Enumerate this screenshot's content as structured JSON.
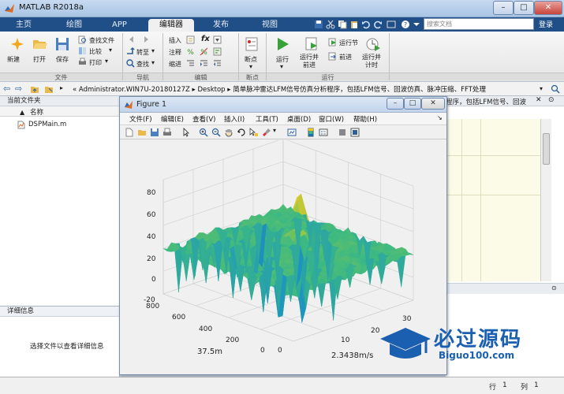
{
  "window": {
    "title": "MATLAB R2018a"
  },
  "tabs": [
    {
      "label": "主页"
    },
    {
      "label": "绘图"
    },
    {
      "label": "APP"
    },
    {
      "label": "编辑器"
    },
    {
      "label": "发布"
    },
    {
      "label": "视图"
    }
  ],
  "search": {
    "placeholder": "搜索文档"
  },
  "login_label": "登录",
  "ribbon": {
    "file": {
      "group": "文件",
      "new": "新建",
      "open": "打开",
      "save": "保存",
      "find_files": "查找文件",
      "compare": "比较",
      "print": "打印"
    },
    "navigate": {
      "group": "导航",
      "goto": "转至",
      "find": "查找"
    },
    "edit": {
      "group": "编辑",
      "insert": "插入",
      "comment": "注释",
      "indent": "缩进",
      "fx": "fx"
    },
    "breakpoints": {
      "group": "断点",
      "label": "断点"
    },
    "run": {
      "group": "运行",
      "run": "运行",
      "run_advance": "运行并\n前进",
      "run_section": "运行节",
      "advance": "前进",
      "run_time": "运行并\n计时"
    }
  },
  "address": {
    "path": "«  Administrator.WIN7U-20180127Z  ▸  Desktop  ▸  简单脉冲雷达LFM信号仿真分析程序，包括LFM信号、回波仿真、脉冲压缩、FFT处理"
  },
  "right_overflow_text": "程序，包括LFM信号、回波",
  "current_folder": {
    "title": "当前文件夹",
    "col_name": "名称",
    "sort_arrow": "▲",
    "files": [
      {
        "name": "DSPMain.m"
      }
    ]
  },
  "details": {
    "title": "详细信息",
    "hint": "选择文件以查看详细信息"
  },
  "status": {
    "row_label": "行",
    "row": "1",
    "col_label": "列",
    "col": "1"
  },
  "figure": {
    "title": "Figure 1",
    "menus": [
      "文件(F)",
      "编辑(E)",
      "查看(V)",
      "插入(I)",
      "工具(T)",
      "桌面(D)",
      "窗口(W)",
      "帮助(H)"
    ],
    "z_ticks": [
      "80",
      "60",
      "40",
      "20",
      "0",
      "-20"
    ],
    "x_ticks": [
      "800",
      "600",
      "400",
      "200",
      "0"
    ],
    "y_ticks": [
      "0",
      "10",
      "20",
      "30"
    ],
    "xlabel": "37.5m",
    "ylabel": "2.3438m/s"
  },
  "watermark": {
    "cn": "必过源码",
    "url": "Biguo100.com"
  },
  "colors": {
    "accent": "#1f4f86",
    "surface_low": "#1a6fb0",
    "surface_mid": "#3fb887",
    "surface_high": "#f2c31a"
  }
}
